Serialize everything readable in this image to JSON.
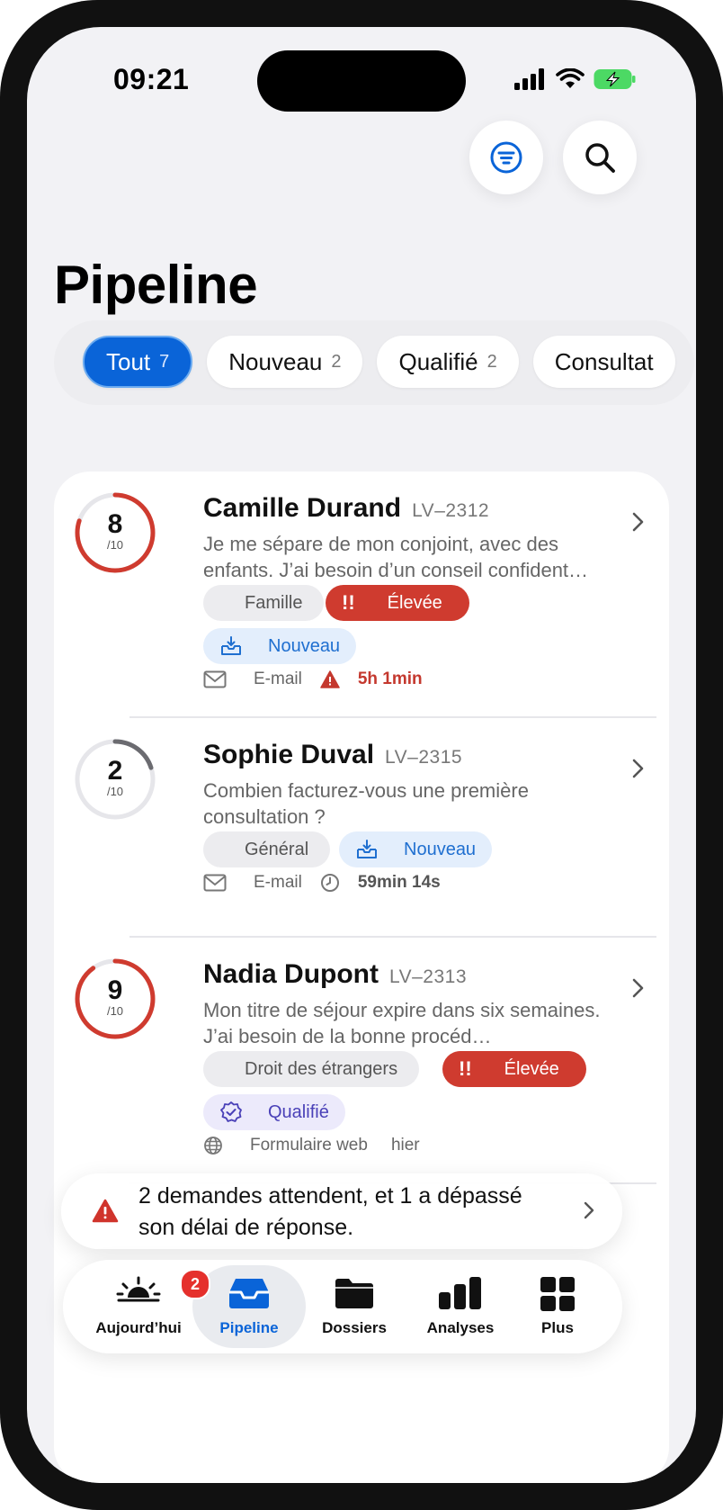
{
  "status_bar": {
    "time": "09:21"
  },
  "page": {
    "title": "Pipeline"
  },
  "filters": [
    {
      "label": "Tout",
      "count": "7",
      "active": true
    },
    {
      "label": "Nouveau",
      "count": "2",
      "active": false
    },
    {
      "label": "Qualifié",
      "count": "2",
      "active": false
    },
    {
      "label": "Consultat",
      "count": "",
      "active": false
    }
  ],
  "leads": [
    {
      "score": "8",
      "score_max": "/10",
      "score_fraction": 0.8,
      "name": "Camille Durand",
      "ref": "LV–2312",
      "desc": "Je me sépare de mon conjoint, avec des enfants. J’ai besoin d’un conseil confident…",
      "category": "Famille",
      "priority": "Élevée",
      "priority_mark": "!!",
      "stage": "Nouveau",
      "channel": "E-mail",
      "timer": "5h 1min",
      "colors": {
        "ring": "#cf3b2f"
      }
    },
    {
      "score": "2",
      "score_max": "/10",
      "score_fraction": 0.2,
      "name": "Sophie Duval",
      "ref": "LV–2315",
      "desc": "Combien facturez-vous une première consultation ?",
      "category": "Général",
      "stage": "Nouveau",
      "channel": "E-mail",
      "timer": "59min 14s",
      "colors": {
        "ring": "#6b6b70"
      }
    },
    {
      "score": "9",
      "score_max": "/10",
      "score_fraction": 0.9,
      "name": "Nadia Dupont",
      "ref": "LV–2313",
      "desc": "Mon titre de séjour expire dans six semaines. J’ai besoin de la bonne procéd…",
      "category": "Droit des étrangers",
      "priority": "Élevée",
      "priority_mark": "!!",
      "stage": "Qualifié",
      "channel": "Formulaire web",
      "timer": "hier",
      "colors": {
        "ring": "#cf3b2f"
      }
    }
  ],
  "banner": {
    "text": "2 demandes attendent, et 1 a dépassé son délai de réponse."
  },
  "tabs": [
    {
      "label": "Aujourd’hui",
      "icon": "sunrise-icon",
      "badge": "2"
    },
    {
      "label": "Pipeline",
      "icon": "tray-icon",
      "selected": true
    },
    {
      "label": "Dossiers",
      "icon": "folder-icon"
    },
    {
      "label": "Analyses",
      "icon": "bar-chart-icon"
    },
    {
      "label": "Plus",
      "icon": "grid-icon"
    }
  ],
  "colors": {
    "accent": "#0a64d8",
    "danger": "#cf3b2f",
    "new_bg": "#e3eefc",
    "qualified_bg": "#eceafb"
  }
}
